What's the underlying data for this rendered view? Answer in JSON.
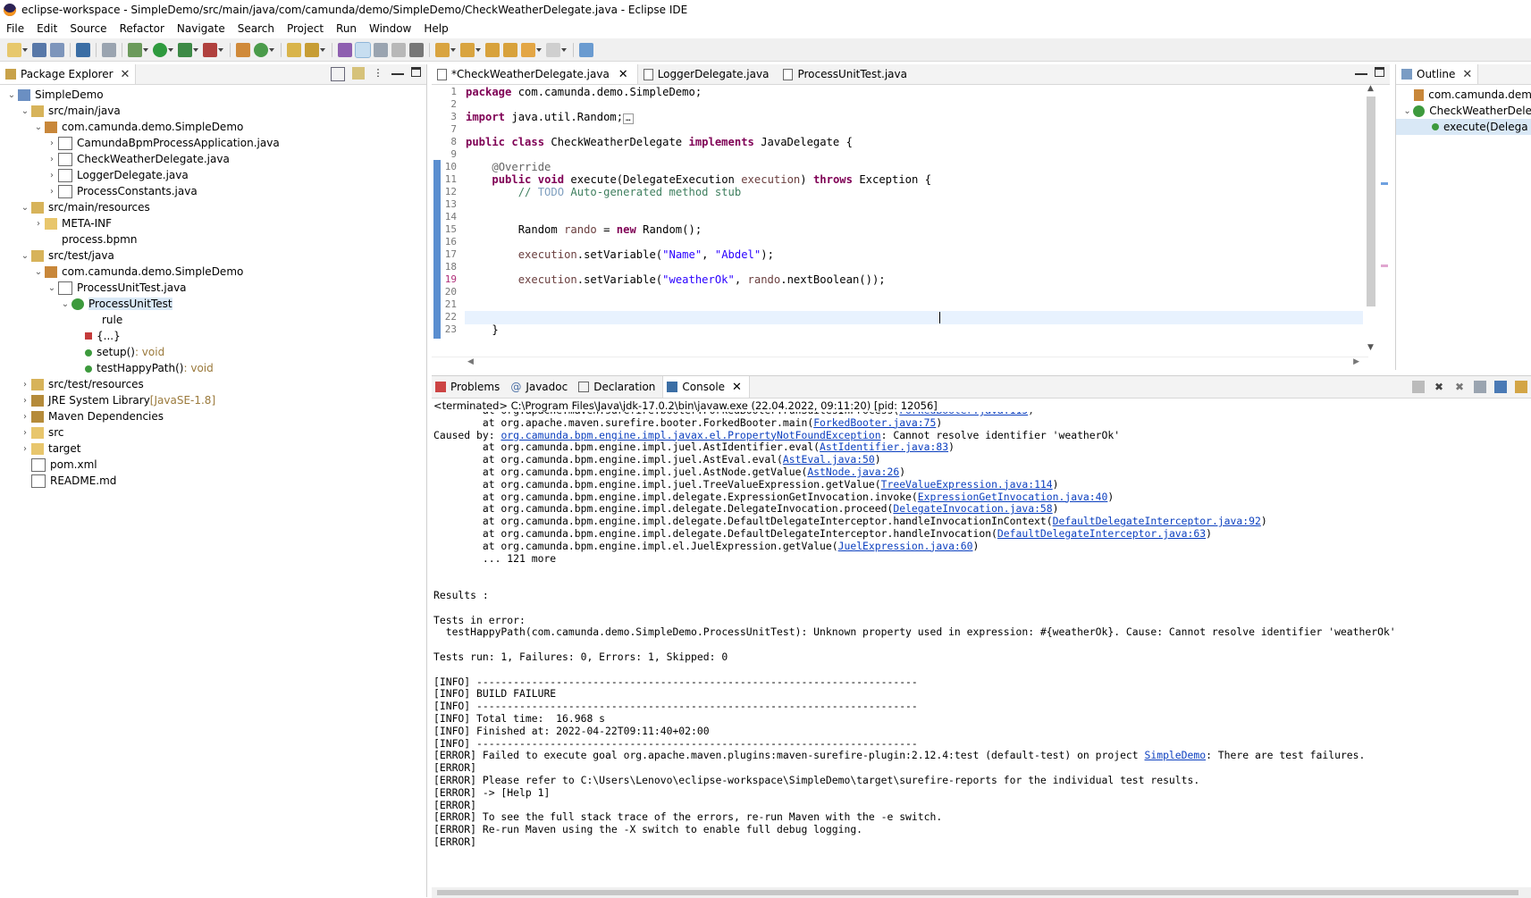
{
  "window": {
    "title": "eclipse-workspace - SimpleDemo/src/main/java/com/camunda/demo/SimpleDemo/CheckWeatherDelegate.java - Eclipse IDE"
  },
  "menu": [
    "File",
    "Edit",
    "Source",
    "Refactor",
    "Navigate",
    "Search",
    "Project",
    "Run",
    "Window",
    "Help"
  ],
  "package_explorer": {
    "title": "Package Explorer",
    "tree": [
      {
        "depth": 0,
        "twisty": "v",
        "icon": "project-icon",
        "label": "SimpleDemo"
      },
      {
        "depth": 1,
        "twisty": "v",
        "icon": "source-folder-icon",
        "label": "src/main/java"
      },
      {
        "depth": 2,
        "twisty": "v",
        "icon": "package-icon",
        "label": "com.camunda.demo.SimpleDemo"
      },
      {
        "depth": 3,
        "twisty": ">",
        "icon": "java-file-icon",
        "label": "CamundaBpmProcessApplication.java"
      },
      {
        "depth": 3,
        "twisty": ">",
        "icon": "java-file-icon",
        "label": "CheckWeatherDelegate.java"
      },
      {
        "depth": 3,
        "twisty": ">",
        "icon": "java-file-icon",
        "label": "LoggerDelegate.java"
      },
      {
        "depth": 3,
        "twisty": ">",
        "icon": "java-file-icon",
        "label": "ProcessConstants.java"
      },
      {
        "depth": 1,
        "twisty": "v",
        "icon": "source-folder-icon",
        "label": "src/main/resources"
      },
      {
        "depth": 2,
        "twisty": ">",
        "icon": "folder-icon",
        "label": "META-INF"
      },
      {
        "depth": 2,
        "twisty": "",
        "icon": "bpmn-file-icon",
        "label": "process.bpmn"
      },
      {
        "depth": 1,
        "twisty": "v",
        "icon": "source-folder-icon",
        "label": "src/test/java"
      },
      {
        "depth": 2,
        "twisty": "v",
        "icon": "package-icon",
        "label": "com.camunda.demo.SimpleDemo"
      },
      {
        "depth": 3,
        "twisty": "v",
        "icon": "java-file-icon",
        "label": "ProcessUnitTest.java"
      },
      {
        "depth": 4,
        "twisty": "v",
        "icon": "class-icon",
        "label": "ProcessUnitTest",
        "selected": true
      },
      {
        "depth": 5,
        "twisty": "",
        "icon": "field-icon",
        "label": "rule"
      },
      {
        "depth": 5,
        "twisty": "",
        "icon": "initializer-icon",
        "label": "{...}"
      },
      {
        "depth": 5,
        "twisty": "",
        "icon": "method-icon",
        "label": "setup()",
        "suffix": " : void"
      },
      {
        "depth": 5,
        "twisty": "",
        "icon": "method-icon",
        "label": "testHappyPath()",
        "suffix": " : void"
      },
      {
        "depth": 1,
        "twisty": ">",
        "icon": "source-folder-icon",
        "label": "src/test/resources"
      },
      {
        "depth": 1,
        "twisty": ">",
        "icon": "library-icon",
        "label": "JRE System Library",
        "suffix": " [JavaSE-1.8]"
      },
      {
        "depth": 1,
        "twisty": ">",
        "icon": "library-icon",
        "label": "Maven Dependencies"
      },
      {
        "depth": 1,
        "twisty": ">",
        "icon": "folder-icon",
        "label": "src"
      },
      {
        "depth": 1,
        "twisty": ">",
        "icon": "folder-icon",
        "label": "target"
      },
      {
        "depth": 1,
        "twisty": "",
        "icon": "xml-file-icon",
        "label": "pom.xml"
      },
      {
        "depth": 1,
        "twisty": "",
        "icon": "text-file-icon",
        "label": "README.md"
      }
    ]
  },
  "editor": {
    "tabs": [
      {
        "label": "*CheckWeatherDelegate.java",
        "active": true
      },
      {
        "label": "LoggerDelegate.java",
        "active": false
      },
      {
        "label": "ProcessUnitTest.java",
        "active": false
      }
    ],
    "line_numbers": [
      "1",
      "2",
      "3",
      "7",
      "8",
      "9",
      "10",
      "11",
      "12",
      "13",
      "14",
      "15",
      "16",
      "17",
      "18",
      "19",
      "20",
      "21",
      "22",
      "23"
    ],
    "current_line": "22"
  },
  "outline": {
    "title": "Outline",
    "items": [
      {
        "icon": "package-icon",
        "label": "com.camunda.dem"
      },
      {
        "icon": "class-icon",
        "label": "CheckWeatherDele"
      },
      {
        "icon": "method-icon",
        "label": "execute(Delega"
      }
    ]
  },
  "console_view": {
    "tabs": [
      {
        "label": "Problems",
        "icon": "problems-icon"
      },
      {
        "label": "Javadoc",
        "icon": "javadoc-icon"
      },
      {
        "label": "Declaration",
        "icon": "declaration-icon"
      },
      {
        "label": "Console",
        "icon": "console-icon",
        "active": true
      }
    ],
    "terminated_label": "<terminated> C:\\Program Files\\Java\\jdk-17.0.2\\bin\\javaw.exe  (22.04.2022, 09:11:20) [pid: 12056]"
  }
}
